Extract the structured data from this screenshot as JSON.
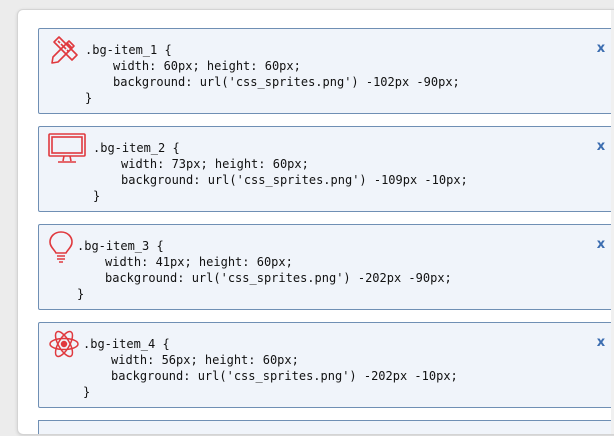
{
  "items": [
    {
      "icon": "pencil-ruler-icon",
      "selector_line": ".bg-item_1 {",
      "size_line": "width: 60px; height: 60px;",
      "background_line": "background: url('css_sprites.png') -102px -90px;",
      "closing_line": "}",
      "remove_label": "x"
    },
    {
      "icon": "monitor-icon",
      "selector_line": ".bg-item_2 {",
      "size_line": "width: 73px; height: 60px;",
      "background_line": "background: url('css_sprites.png') -109px -10px;",
      "closing_line": "}",
      "remove_label": "x"
    },
    {
      "icon": "lightbulb-icon",
      "selector_line": ".bg-item_3 {",
      "size_line": "width: 41px; height: 60px;",
      "background_line": "background: url('css_sprites.png') -202px -90px;",
      "closing_line": "}",
      "remove_label": "x"
    },
    {
      "icon": "atom-icon",
      "selector_line": ".bg-item_4 {",
      "size_line": "width: 56px; height: 60px;",
      "background_line": "background: url('css_sprites.png') -202px -10px;",
      "closing_line": "}",
      "remove_label": "x"
    }
  ],
  "colors": {
    "icon_red": "#e0393e",
    "card_border": "#6f8fb4",
    "card_bg": "#f0f4fa",
    "close_blue": "#3c6db0"
  }
}
